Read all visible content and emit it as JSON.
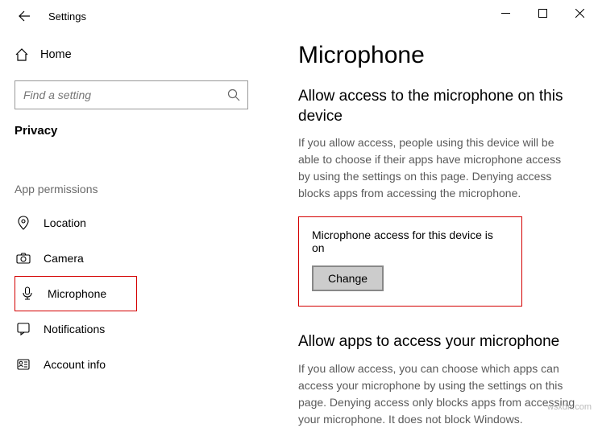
{
  "window": {
    "title": "Settings"
  },
  "sidebar": {
    "home_label": "Home",
    "search_placeholder": "Find a setting",
    "category": "Privacy",
    "section_header": "App permissions",
    "items": [
      {
        "label": "Location"
      },
      {
        "label": "Camera"
      },
      {
        "label": "Microphone"
      },
      {
        "label": "Notifications"
      },
      {
        "label": "Account info"
      }
    ]
  },
  "content": {
    "page_title": "Microphone",
    "section1_head": "Allow access to the microphone on this device",
    "section1_body": "If you allow access, people using this device will be able to choose if their apps have microphone access by using the settings on this page. Denying access blocks apps from accessing the microphone.",
    "status_line": "Microphone access for this device is on",
    "change_label": "Change",
    "section2_head": "Allow apps to access your microphone",
    "section2_body": "If you allow access, you can choose which apps can access your microphone by using the settings on this page. Denying access only blocks apps from accessing your microphone. It does not block Windows."
  },
  "watermark": "wsxdn.com"
}
